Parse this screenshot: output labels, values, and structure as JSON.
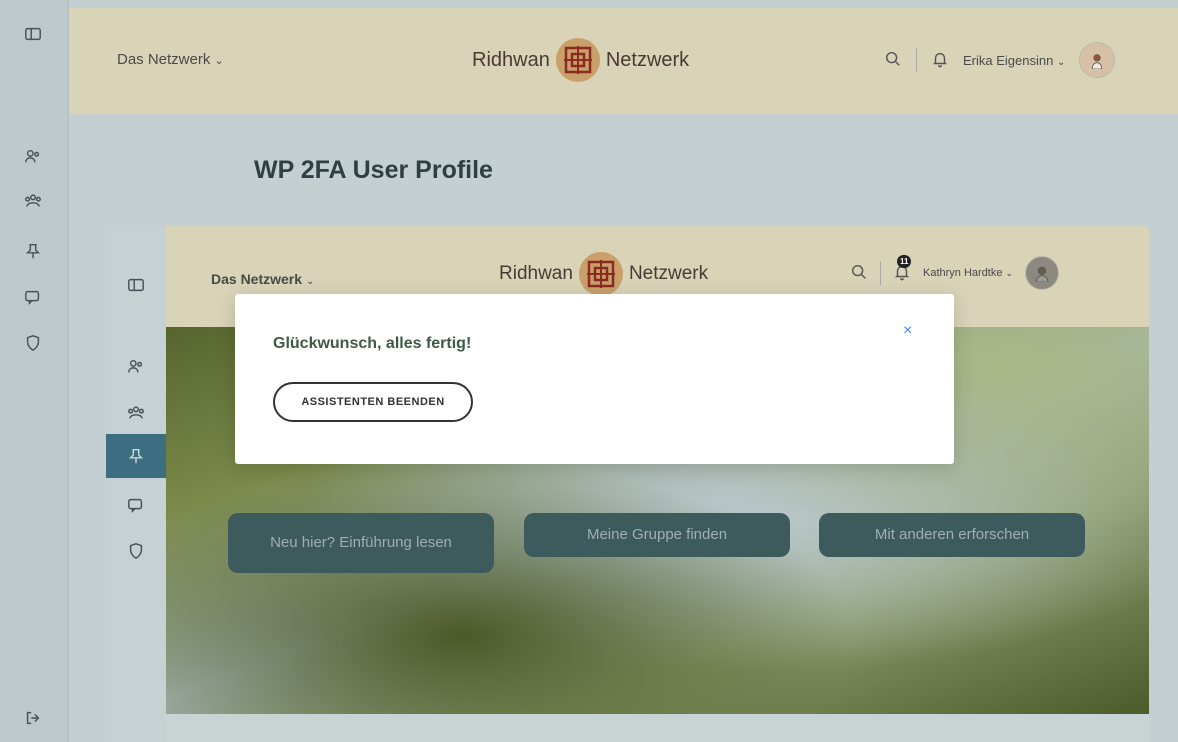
{
  "outer_header": {
    "network_menu": "Das Netzwerk",
    "logo_left": "Ridhwan",
    "logo_right": "Netzwerk",
    "user_name": "Erika Eigensinn"
  },
  "page_title": "WP 2FA User Profile",
  "inner_header": {
    "network_menu": "Das Netzwerk",
    "logo_left": "Ridhwan",
    "logo_right": "Netzwerk",
    "notification_count": "11",
    "user_name": "Kathryn Hardtke"
  },
  "hero_buttons": [
    {
      "label": "Neu hier? Einführung lesen"
    },
    {
      "label": "Meine Gruppe finden"
    },
    {
      "label": "Mit anderen erforschen"
    }
  ],
  "modal": {
    "title": "Glückwunsch, alles fertig!",
    "button_label": "ASSISTENTEN BEENDEN",
    "close_symbol": "×"
  },
  "colors": {
    "header_bg": "#d9d3b8",
    "sidebar_bg": "#bdc9ca",
    "hero_button_bg": "#3d5a5c",
    "active_sidebar": "#3a6e80",
    "modal_title": "#3d5a46",
    "close_icon": "#4a8cd8"
  }
}
